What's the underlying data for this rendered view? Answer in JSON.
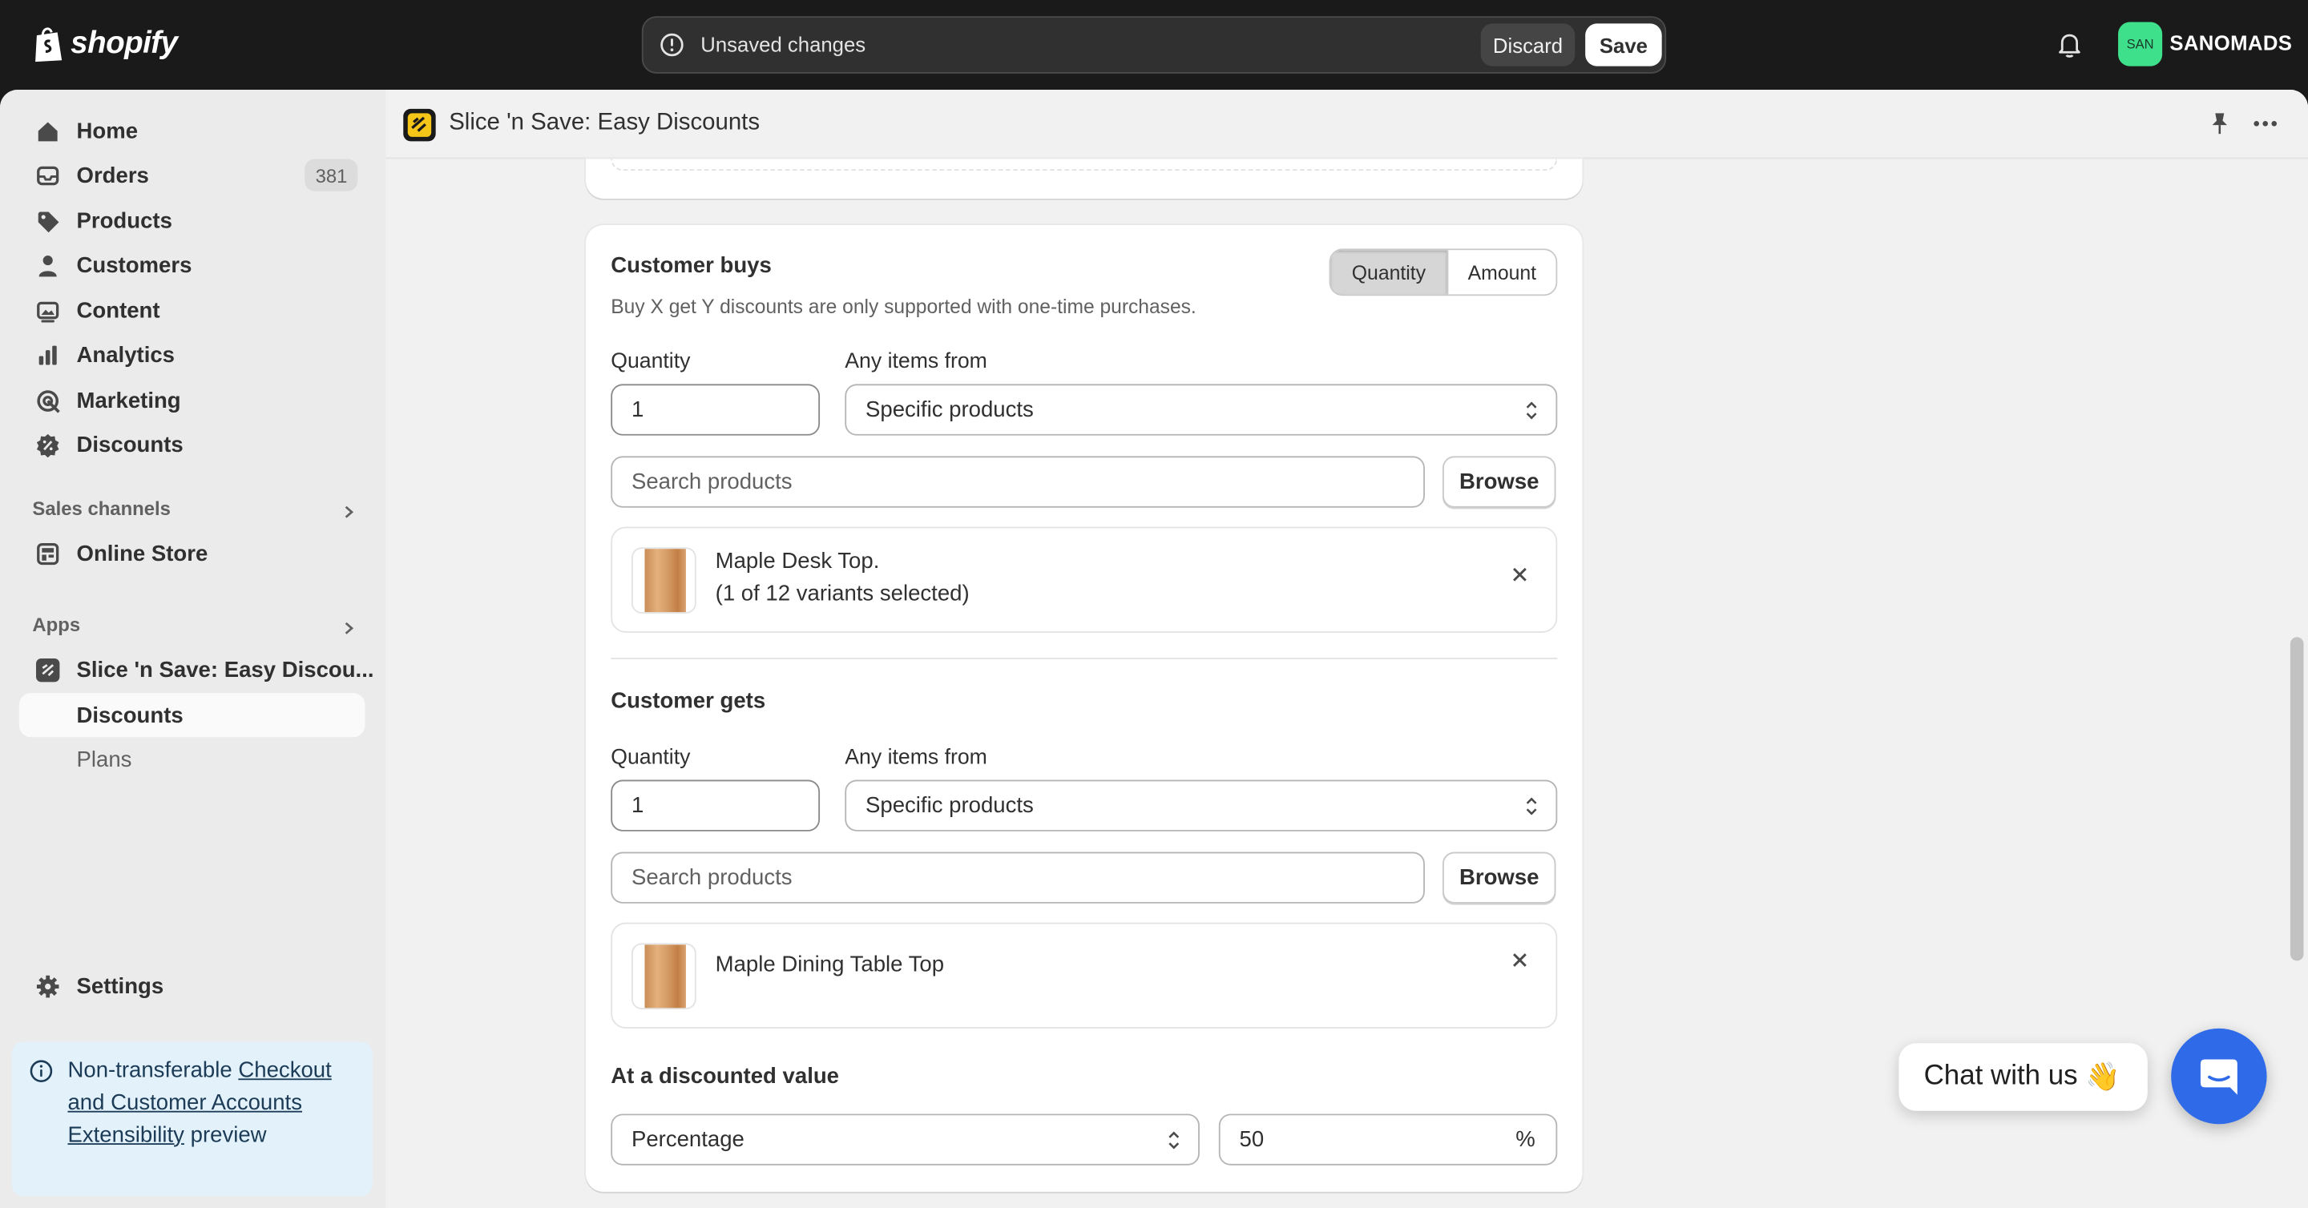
{
  "brand": {
    "wordmark": "shopify",
    "icon": "shopify-bag-icon"
  },
  "topbar": {
    "unsaved_message": "Unsaved changes",
    "discard_label": "Discard",
    "save_label": "Save",
    "avatar_initials": "SAN",
    "store_name": "SANOMADS"
  },
  "sidebar": {
    "items": [
      {
        "label": "Home",
        "icon": "home-icon"
      },
      {
        "label": "Orders",
        "icon": "inbox-icon",
        "badge": "381"
      },
      {
        "label": "Products",
        "icon": "tag-icon"
      },
      {
        "label": "Customers",
        "icon": "person-icon"
      },
      {
        "label": "Content",
        "icon": "image-icon"
      },
      {
        "label": "Analytics",
        "icon": "bar-chart-icon"
      },
      {
        "label": "Marketing",
        "icon": "target-icon"
      },
      {
        "label": "Discounts",
        "icon": "discount-icon"
      }
    ],
    "sales_channels_heading": "Sales channels",
    "online_store": "Online Store",
    "apps_heading": "Apps",
    "app_name": "Slice 'n Save: Easy Discou...",
    "app_sub_discounts": "Discounts",
    "app_sub_plans": "Plans",
    "settings": "Settings",
    "preview_banner": {
      "prefix": "Non-transferable",
      "link": "Checkout and Customer Accounts Extensibility",
      "suffix": "preview"
    }
  },
  "app_header": {
    "title": "Slice 'n Save: Easy Discounts"
  },
  "customer_buys": {
    "heading": "Customer buys",
    "help": "Buy X get Y discounts are only supported with one-time purchases.",
    "toggle": {
      "quantity": "Quantity",
      "amount": "Amount",
      "selected": "Quantity"
    },
    "quantity_label": "Quantity",
    "quantity_value": "1",
    "items_from_label": "Any items from",
    "items_from_value": "Specific products",
    "search_placeholder": "Search products",
    "browse_label": "Browse",
    "product": {
      "name": "Maple Desk Top.",
      "variants": "(1 of 12 variants selected)"
    }
  },
  "customer_gets": {
    "heading": "Customer gets",
    "quantity_label": "Quantity",
    "quantity_value": "1",
    "items_from_label": "Any items from",
    "items_from_value": "Specific products",
    "search_placeholder": "Search products",
    "browse_label": "Browse",
    "product": {
      "name": "Maple Dining Table Top"
    }
  },
  "discounted_value": {
    "heading": "At a discounted value",
    "type_value": "Percentage",
    "amount_value": "50",
    "suffix": "%"
  },
  "chat": {
    "bubble_text": "Chat with us",
    "emoji": "👋"
  },
  "colors": {
    "chat_blue": "#2f6be8",
    "avatar_green": "#3ee08c",
    "topbar": "#1a1a1a"
  }
}
